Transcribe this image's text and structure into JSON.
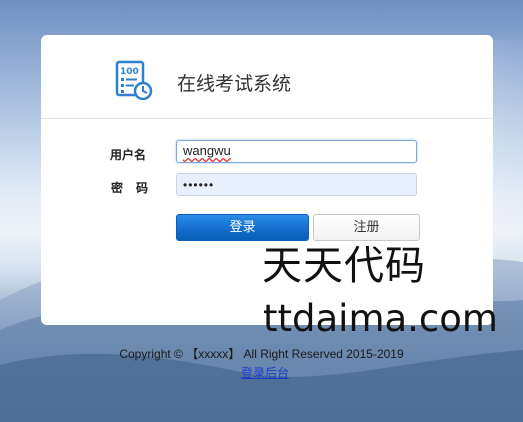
{
  "app": {
    "title": "在线考试系统",
    "logo_icon": "exam-score-clock-icon"
  },
  "form": {
    "username_label": "用户名",
    "username_value": "wangwu",
    "password_label": "密码",
    "password_mask": "••••••"
  },
  "buttons": {
    "login_label": "登录",
    "register_label": "注册"
  },
  "watermark": {
    "line1": "天天代码",
    "line2": "ttdaima.com"
  },
  "footer": {
    "copyright": "Copyright © 【xxxxx】 All Right Reserved 2015-2019",
    "admin_link": "登录后台"
  },
  "colors": {
    "primary_button": "#1570d0",
    "link": "#1a3fcc",
    "icon": "#2f7fd0"
  }
}
